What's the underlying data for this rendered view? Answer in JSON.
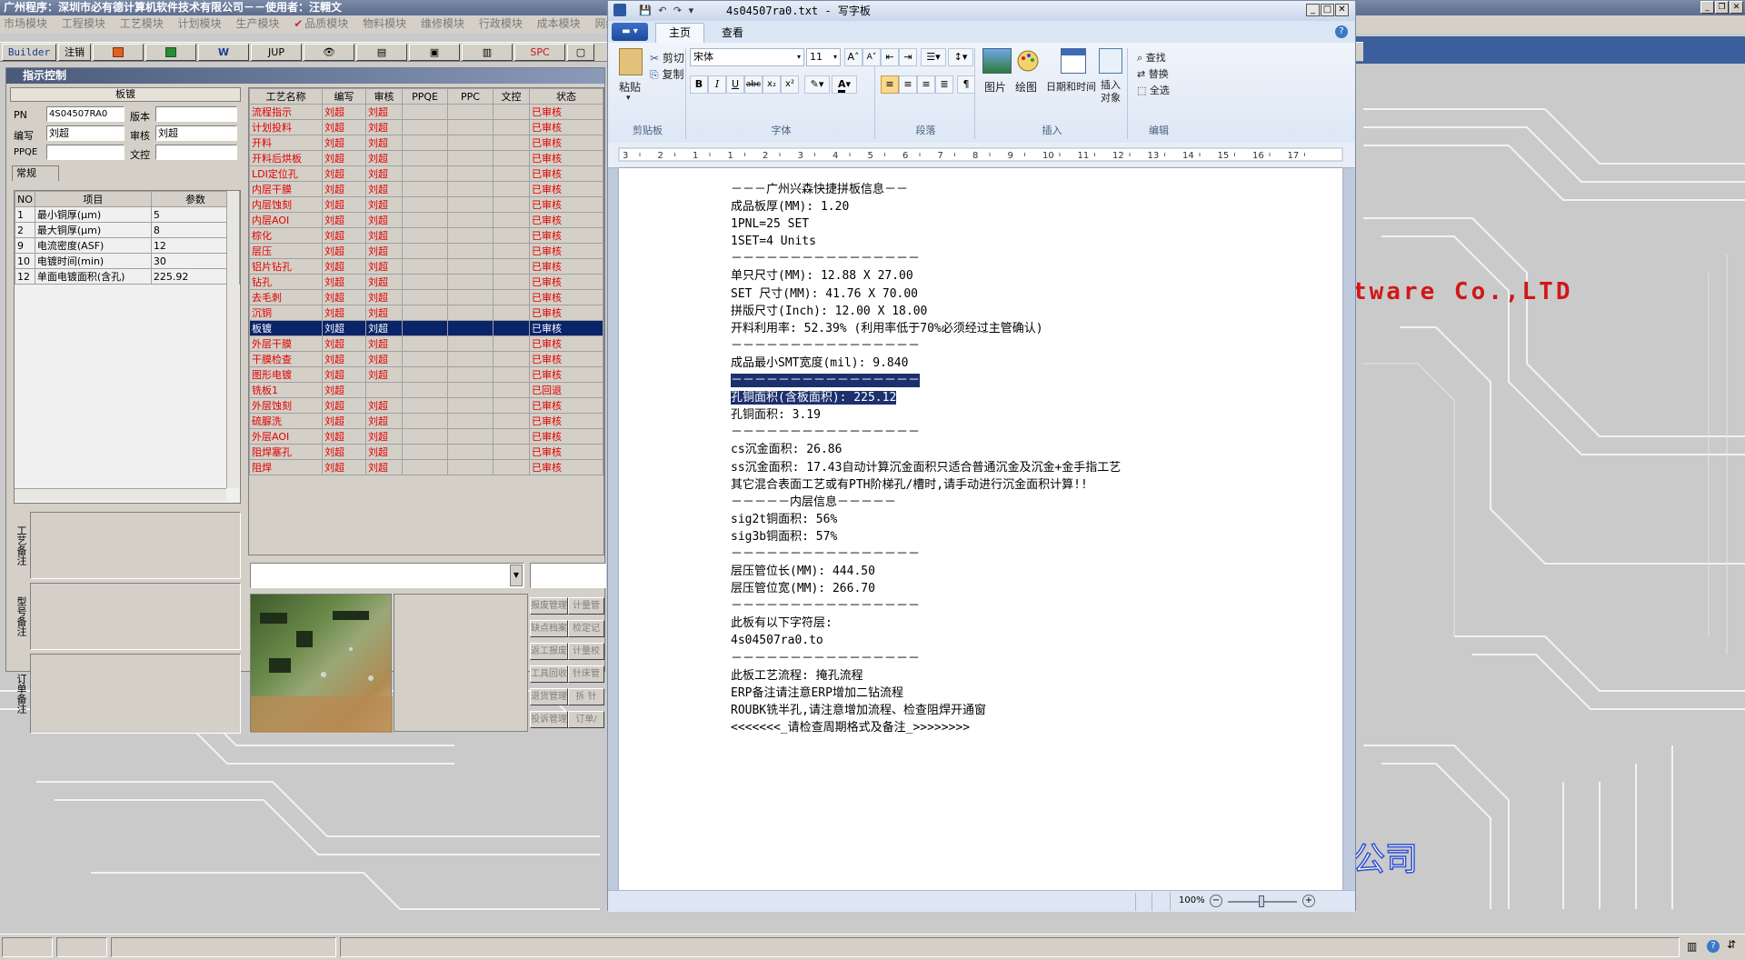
{
  "app": {
    "title": "广州程序：深圳市必有德计算机软件技术有限公司－－使用者：汪翱文",
    "menu": [
      "市场模块",
      "工程模块",
      "工艺模块",
      "计划模块",
      "生产模块",
      "品质模块",
      "物料模块",
      "维修模块",
      "行政模块",
      "成本模块",
      "网络模"
    ],
    "menu_check": "✔",
    "toolbar": [
      "Builder",
      "注销",
      "",
      "",
      "W",
      "JUP",
      "",
      "",
      "",
      "",
      "SPC",
      ""
    ],
    "background_banner": "tware Co.,LTD",
    "background_banner2": "公司"
  },
  "panel": {
    "title": "指示控制",
    "board_header": "板镀",
    "fields": {
      "pn_label": "PN",
      "pn_value": "4S04507RA0",
      "version_label": "版本",
      "version_value": "",
      "author_label": "编写",
      "author_value": "刘超",
      "review_label": "审核",
      "review_value": "刘超",
      "ppqe_label": "PPQE",
      "ppqe_value": "",
      "doc_label": "文控",
      "doc_value": ""
    },
    "tab": "常规",
    "params_headers": [
      "NO",
      "项目",
      "参数"
    ],
    "params": [
      {
        "no": "1",
        "item": "最小铜厚(μm)",
        "val": "5"
      },
      {
        "no": "2",
        "item": "最大铜厚(μm)",
        "val": "8"
      },
      {
        "no": "9",
        "item": "电流密度(ASF)",
        "val": "12"
      },
      {
        "no": "10",
        "item": "电镀时间(min)",
        "val": "30"
      },
      {
        "no": "12",
        "item": "单面电镀面积(含孔)",
        "val": "225.92"
      }
    ],
    "side_labels": [
      "工艺备注",
      "型号备注",
      "订单备注"
    ],
    "process_headers": [
      "工艺名称",
      "编写",
      "审核",
      "PPQE",
      "PPC",
      "文控",
      "状态"
    ],
    "process": [
      {
        "name": "流程指示",
        "a": "刘超",
        "r": "刘超",
        "s": "已审核"
      },
      {
        "name": "计划投料",
        "a": "刘超",
        "r": "刘超",
        "s": "已审核"
      },
      {
        "name": "开料",
        "a": "刘超",
        "r": "刘超",
        "s": "已审核"
      },
      {
        "name": "开料后烘板",
        "a": "刘超",
        "r": "刘超",
        "s": "已审核"
      },
      {
        "name": "LDI定位孔",
        "a": "刘超",
        "r": "刘超",
        "s": "已审核"
      },
      {
        "name": "内层干膜",
        "a": "刘超",
        "r": "刘超",
        "s": "已审核"
      },
      {
        "name": "内层蚀刻",
        "a": "刘超",
        "r": "刘超",
        "s": "已审核"
      },
      {
        "name": "内层AOI",
        "a": "刘超",
        "r": "刘超",
        "s": "已审核"
      },
      {
        "name": "棕化",
        "a": "刘超",
        "r": "刘超",
        "s": "已审核"
      },
      {
        "name": "层压",
        "a": "刘超",
        "r": "刘超",
        "s": "已审核"
      },
      {
        "name": "铝片钻孔",
        "a": "刘超",
        "r": "刘超",
        "s": "已审核"
      },
      {
        "name": "钻孔",
        "a": "刘超",
        "r": "刘超",
        "s": "已审核"
      },
      {
        "name": "去毛刺",
        "a": "刘超",
        "r": "刘超",
        "s": "已审核"
      },
      {
        "name": "沉铜",
        "a": "刘超",
        "r": "刘超",
        "s": "已审核"
      },
      {
        "name": "板镀",
        "a": "刘超",
        "r": "刘超",
        "s": "已审核",
        "selected": true
      },
      {
        "name": "外层干膜",
        "a": "刘超",
        "r": "刘超",
        "s": "已审核"
      },
      {
        "name": "干膜检查",
        "a": "刘超",
        "r": "刘超",
        "s": "已审核"
      },
      {
        "name": "图形电镀",
        "a": "刘超",
        "r": "刘超",
        "s": "已审核"
      },
      {
        "name": "铣板1",
        "a": "刘超",
        "r": "",
        "s": "已回退"
      },
      {
        "name": "外层蚀刻",
        "a": "刘超",
        "r": "刘超",
        "s": "已审核"
      },
      {
        "name": "硫脲洗",
        "a": "刘超",
        "r": "刘超",
        "s": "已审核"
      },
      {
        "name": "外层AOI",
        "a": "刘超",
        "r": "刘超",
        "s": "已审核"
      },
      {
        "name": "阻焊塞孔",
        "a": "刘超",
        "r": "刘超",
        "s": "已审核"
      },
      {
        "name": "阻焊",
        "a": "刘超",
        "r": "刘超",
        "s": "已审核"
      }
    ],
    "side_buttons": [
      [
        "报废管理",
        "计量管"
      ],
      [
        "缺点档案",
        "检定记"
      ],
      [
        "返工报废",
        "计量校"
      ],
      [
        "工具回收",
        "针床管"
      ],
      [
        "退货管理",
        "拆 针"
      ],
      [
        "投诉管理",
        "订单/"
      ]
    ]
  },
  "wordpad": {
    "title": "4s04507ra0.txt - 写字板",
    "tabs": [
      "主页",
      "查看"
    ],
    "clipboard": {
      "paste": "粘贴",
      "cut": "剪切",
      "copy": "复制",
      "label": "剪贴板"
    },
    "font": {
      "name": "宋体",
      "size": "11",
      "label": "字体"
    },
    "paragraph_label": "段落",
    "insert": {
      "picture": "图片",
      "paint": "绘图",
      "datetime": "日期和时间",
      "object": "插入对象",
      "label": "插入"
    },
    "edit": {
      "find": "查找",
      "replace": "替换",
      "select_all": "全选",
      "label": "编辑"
    },
    "ruler": [
      "3",
      "2",
      "1",
      "1",
      "2",
      "3",
      "4",
      "5",
      "6",
      "7",
      "8",
      "9",
      "10",
      "11",
      "12",
      "13",
      "14",
      "15",
      "16",
      "17"
    ],
    "zoom": "100%",
    "lines": [
      "－－－广州兴森快捷拼板信息－－",
      "成品板厚(MM): 1.20",
      "1PNL=25 SET",
      "1SET=4 Units",
      "－－－－－－－－－－－－－－－－",
      "单只尺寸(MM): 12.88 X 27.00",
      "SET 尺寸(MM): 41.76 X 70.00",
      "拼版尺寸(Inch): 12.00 X 18.00",
      "开料利用率: 52.39% (利用率低于70%必须经过主管确认)",
      "－－－－－－－－－－－－－－－－",
      "成品最小SMT宽度(mil): 9.840",
      "－－－－－－－－－－－－－－－－",
      "孔铜面积(含板面积): 225.12",
      "孔铜面积: 3.19",
      "－－－－－－－－－－－－－－－－",
      "cs沉金面积: 26.86",
      "ss沉金面积: 17.43自动计算沉金面积只适合普通沉金及沉金+金手指工艺",
      "其它混合表面工艺或有PTH阶梯孔/槽时,请手动进行沉金面积计算!!",
      "－－－－－内层信息－－－－－",
      "sig2t铜面积: 56%",
      "sig3b铜面积: 57%",
      "－－－－－－－－－－－－－－－－",
      "层压管位长(MM): 444.50",
      "层压管位宽(MM): 266.70",
      "－－－－－－－－－－－－－－－－",
      "此板有以下字符层:",
      "4s04507ra0.to",
      "－－－－－－－－－－－－－－－－",
      "此板工艺流程: 掩孔流程",
      "ERP备注请注意ERP增加二钻流程",
      "ROUBK铣半孔,请注意增加流程、检查阻焊开通窗",
      "<<<<<<<_请检查周期格式及备注_>>>>>>>>"
    ]
  }
}
